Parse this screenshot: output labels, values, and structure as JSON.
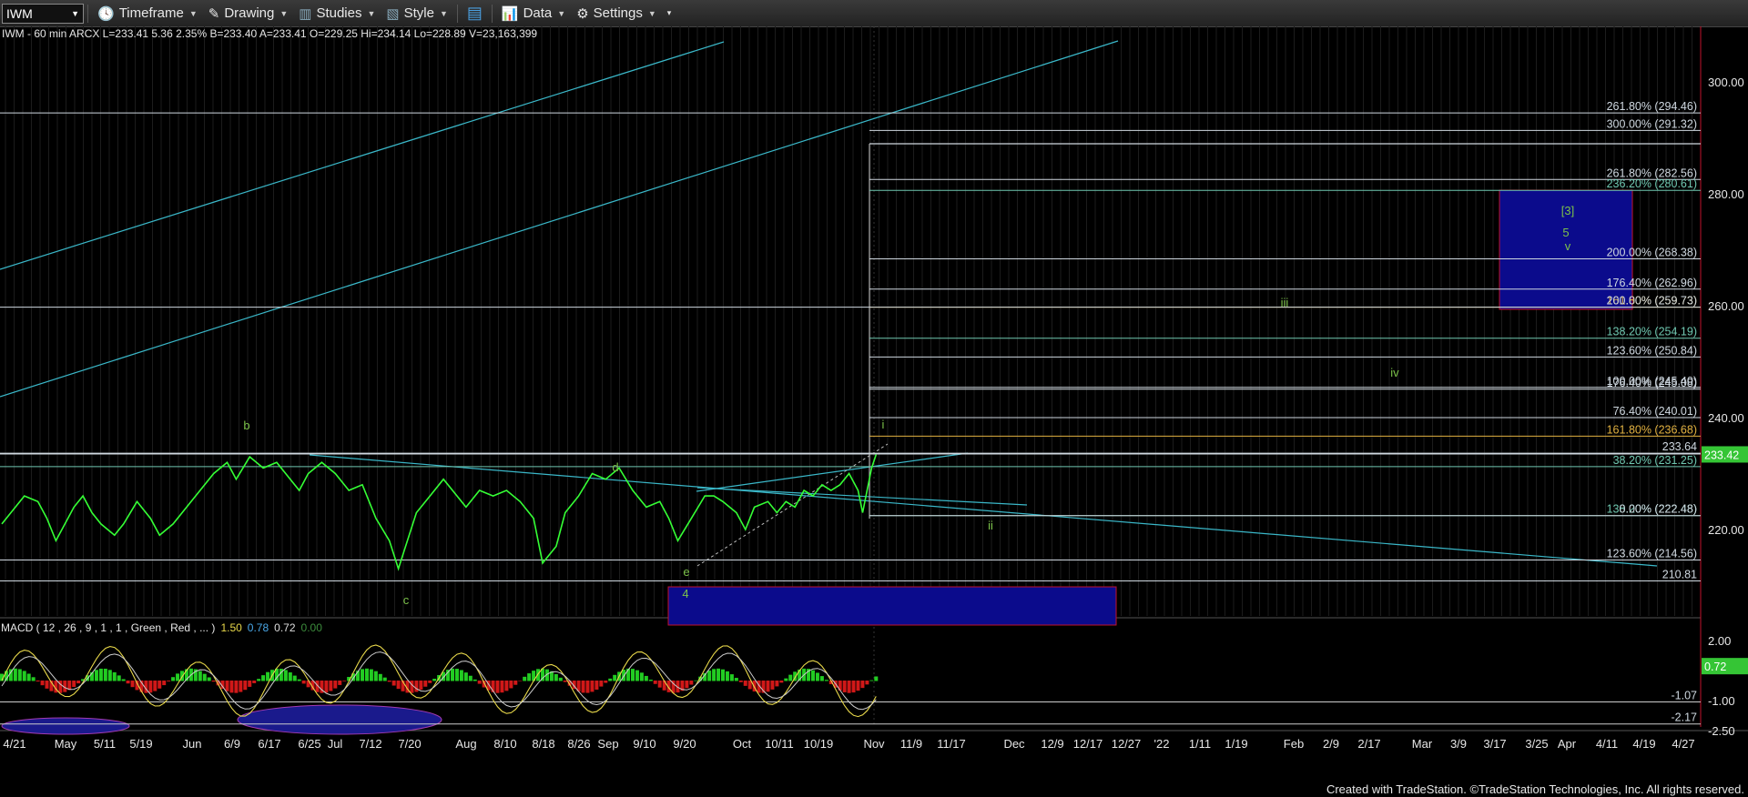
{
  "toolbar": {
    "symbol": "IWM",
    "items": [
      "Timeframe",
      "Drawing",
      "Studies",
      "Style",
      "Data",
      "Settings"
    ]
  },
  "header": {
    "text": "IWM - 60 min  ARCX  L=233.41  5.36  2.35%  B=233.40  A=233.41  O=229.25  Hi=234.14  Lo=228.89  V=23,163,399"
  },
  "macd_header": {
    "label": "MACD ( 12 , 26 , 9 , 1 , 1 , Green , Red , ... )",
    "v1": "1.50",
    "v2": "0.78",
    "v3": "0.72",
    "v4": "0.00",
    "colors": {
      "v1": "#e8d84a",
      "v2": "#4aa8e8",
      "v3": "#dddddd",
      "v4": "#3c8c3c"
    }
  },
  "footer": "Created with TradeStation. ©TradeStation Technologies, Inc. All rights reserved.",
  "colors": {
    "price": "#35ff35",
    "channel": "#3ab7c8",
    "fib_line": "#b8c7d6",
    "wave": "#7cc24a",
    "box_fill": "#0b0b8c",
    "box_border": "#c0122c"
  },
  "chart_data": {
    "type": "line",
    "title": "IWM - 60 min",
    "x_ticks": [
      "4/21",
      "May",
      "5/11",
      "5/19",
      "Jun",
      "6/9",
      "6/17",
      "6/25",
      "Jul",
      "7/12",
      "7/20",
      "Aug",
      "8/10",
      "8/18",
      "8/26",
      "Sep",
      "9/10",
      "9/20",
      "Oct",
      "10/11",
      "10/19",
      "Nov",
      "11/9",
      "11/17",
      "Dec",
      "12/9",
      "12/17",
      "12/27",
      "'22",
      "1/11",
      "1/19",
      "Feb",
      "2/9",
      "2/17",
      "Mar",
      "3/9",
      "3/17",
      "3/25",
      "Apr",
      "4/11",
      "4/19",
      "4/27"
    ],
    "price_axis": {
      "ylim": [
        206,
        306
      ],
      "ticks": [
        220,
        240,
        260,
        280,
        300
      ]
    },
    "series": [
      {
        "name": "IWM",
        "values": [
          [
            0,
            221
          ],
          [
            3,
            224
          ],
          [
            5,
            226
          ],
          [
            8,
            225
          ],
          [
            10,
            222
          ],
          [
            12,
            218
          ],
          [
            14,
            221
          ],
          [
            16,
            224
          ],
          [
            18,
            226
          ],
          [
            20,
            223
          ],
          [
            22,
            221
          ],
          [
            25,
            219
          ],
          [
            27,
            221
          ],
          [
            30,
            225
          ],
          [
            33,
            222
          ],
          [
            35,
            219
          ],
          [
            38,
            221
          ],
          [
            41,
            224
          ],
          [
            44,
            227
          ],
          [
            47,
            230
          ],
          [
            50,
            232
          ],
          [
            52,
            229
          ],
          [
            55,
            233
          ],
          [
            58,
            231
          ],
          [
            61,
            232
          ],
          [
            64,
            229
          ],
          [
            66,
            227
          ],
          [
            68,
            230
          ],
          [
            71,
            232
          ],
          [
            74,
            230
          ],
          [
            77,
            227
          ],
          [
            80,
            228
          ],
          [
            83,
            222
          ],
          [
            86,
            218
          ],
          [
            88,
            213
          ],
          [
            90,
            218
          ],
          [
            92,
            223
          ],
          [
            95,
            226
          ],
          [
            98,
            229
          ],
          [
            101,
            226
          ],
          [
            103,
            224
          ],
          [
            106,
            227
          ],
          [
            109,
            226
          ],
          [
            112,
            227
          ],
          [
            115,
            225
          ],
          [
            118,
            222
          ],
          [
            120,
            214
          ],
          [
            123,
            217
          ],
          [
            125,
            223
          ],
          [
            128,
            226
          ],
          [
            131,
            230
          ],
          [
            134,
            229
          ],
          [
            137,
            231
          ],
          [
            140,
            227
          ],
          [
            143,
            224
          ],
          [
            146,
            225
          ],
          [
            148,
            222
          ],
          [
            150,
            218
          ],
          [
            153,
            222
          ],
          [
            156,
            226
          ],
          [
            158,
            226
          ],
          [
            160,
            225
          ],
          [
            163,
            223
          ],
          [
            165,
            220
          ],
          [
            167,
            224
          ],
          [
            170,
            225
          ],
          [
            172,
            223
          ],
          [
            174,
            225
          ],
          [
            176,
            224
          ],
          [
            178,
            227
          ],
          [
            180,
            226
          ],
          [
            182,
            228
          ],
          [
            184,
            227
          ],
          [
            186,
            228
          ],
          [
            188,
            230
          ],
          [
            190,
            227
          ],
          [
            191,
            223
          ],
          [
            192,
            227
          ],
          [
            193,
            231
          ],
          [
            194,
            233.4
          ]
        ]
      }
    ],
    "horizontal_levels": [
      {
        "label": "261.80% (294.46)",
        "value": 294.46
      },
      {
        "label": "300.00% (291.32)",
        "value": 291.32
      },
      {
        "label": "261.80% (282.56)",
        "value": 282.56
      },
      {
        "label": "236.20% (280.61)",
        "value": 280.61
      },
      {
        "label": "200.00% (268.38)",
        "value": 268.38
      },
      {
        "label": "176.40% (262.96)",
        "value": 262.96
      },
      {
        "label": "161.80% (259.73)",
        "value": 259.73
      },
      {
        "label": "200.00% (259.73)",
        "value": 259.73
      },
      {
        "label": "138.20% (254.19)",
        "value": 254.19
      },
      {
        "label": "123.60% (250.84)",
        "value": 250.84
      },
      {
        "label": "100.00% (245.40)",
        "value": 245.4
      },
      {
        "label": "176.40% (245.08)",
        "value": 245.08
      },
      {
        "label": "76.40% (240.01)",
        "value": 240.01
      },
      {
        "label": "161.80% (236.68)",
        "value": 236.68
      },
      {
        "label": "233.64",
        "value": 233.64
      },
      {
        "label": "38.20% (231.25)",
        "value": 231.25
      },
      {
        "label": "138.20% (222.48)",
        "value": 222.48
      },
      {
        "label": "0.00% (222.48)",
        "value": 222.48
      },
      {
        "label": "123.60% (214.56)",
        "value": 214.56
      },
      {
        "label": "210.81",
        "value": 210.81
      }
    ],
    "last_price": "233.42",
    "wave_labels": [
      "b",
      "c",
      "d",
      "e",
      "4",
      "i",
      "ii",
      "iii",
      "iv",
      "5",
      "v",
      "[3]"
    ],
    "macd": {
      "ylim": [
        -3.0,
        3.0
      ],
      "ticks": [
        "2.00",
        "-1.00",
        "-2.50"
      ],
      "levels": [
        "-1.07",
        "-2.17"
      ],
      "last": "0.72"
    }
  }
}
